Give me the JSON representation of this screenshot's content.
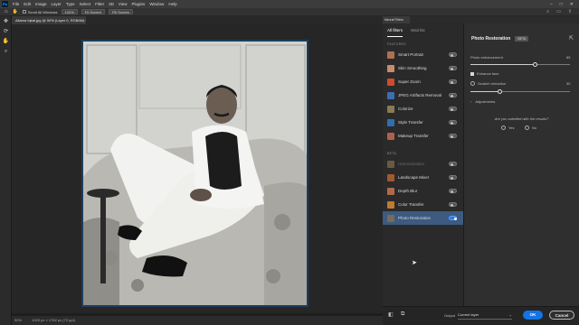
{
  "menubar": {
    "app_icon": "Ps",
    "items": [
      "File",
      "Edit",
      "Image",
      "Layer",
      "Type",
      "Select",
      "Filter",
      "3D",
      "View",
      "Plugins",
      "Window",
      "Help"
    ]
  },
  "options_bar": {
    "scroll_all_windows": "Scroll All Windows",
    "zoom_100": "100%",
    "fit_screen": "Fit Screen",
    "fill_screen": "Fill Screen"
  },
  "document": {
    "tab_title": "Allama Iqbal.jpg @ 50% (Layer 0, RGB/8#) *",
    "status_zoom": "50%",
    "status_size": "1020 px × 1762 px (72 ppi)"
  },
  "neural_filters": {
    "panel_title": "Neural Filters",
    "tabs": [
      "All filters",
      "Wait list"
    ],
    "sections": {
      "featured": "FEATURED",
      "beta": "BETA"
    },
    "featured_filters": [
      {
        "label": "Smart Portrait",
        "color": "#b07050",
        "on": false
      },
      {
        "label": "Skin Smoothing",
        "color": "#c98a70",
        "on": false
      },
      {
        "label": "Super Zoom",
        "color": "#d04a30",
        "on": false
      },
      {
        "label": "JPEG Artifacts Removal",
        "color": "#3a6fb0",
        "on": false
      },
      {
        "label": "Colorize",
        "color": "#8a7a55",
        "on": false
      },
      {
        "label": "Style Transfer",
        "color": "#2f6fb0",
        "on": false
      },
      {
        "label": "Makeup Transfer",
        "color": "#b0604a",
        "on": false
      }
    ],
    "beta_filters": [
      {
        "label": "Harmonization",
        "color": "#6a5a40",
        "on": false,
        "disabled": true
      },
      {
        "label": "Landscape Mixer",
        "color": "#a05a30",
        "on": false
      },
      {
        "label": "Depth Blur",
        "color": "#b06a4a",
        "on": false
      },
      {
        "label": "Color Transfer",
        "color": "#c07a30",
        "on": false
      },
      {
        "label": "Photo Restoration",
        "color": "#7a6a5a",
        "on": true,
        "selected": true
      }
    ],
    "detail": {
      "title": "Photo Restoration",
      "badge": "BETA",
      "photo_enhancement_label": "Photo enhancement",
      "photo_enhancement_value": "65",
      "photo_enhancement_level": 0.65,
      "enhance_face_label": "Enhance face",
      "enhance_face_checked": true,
      "scratch_reduction_label": "Scratch reduction",
      "scratch_reduction_value": "30",
      "scratch_reduction_level": 0.3,
      "adjustments_label": "Adjustments",
      "feedback_question": "Are you satisfied with the results?",
      "yes_label": "Yes",
      "no_label": "No"
    },
    "output_label": "Output",
    "output_value": "Current layer",
    "ok_label": "OK",
    "cancel_label": "Cancel"
  }
}
